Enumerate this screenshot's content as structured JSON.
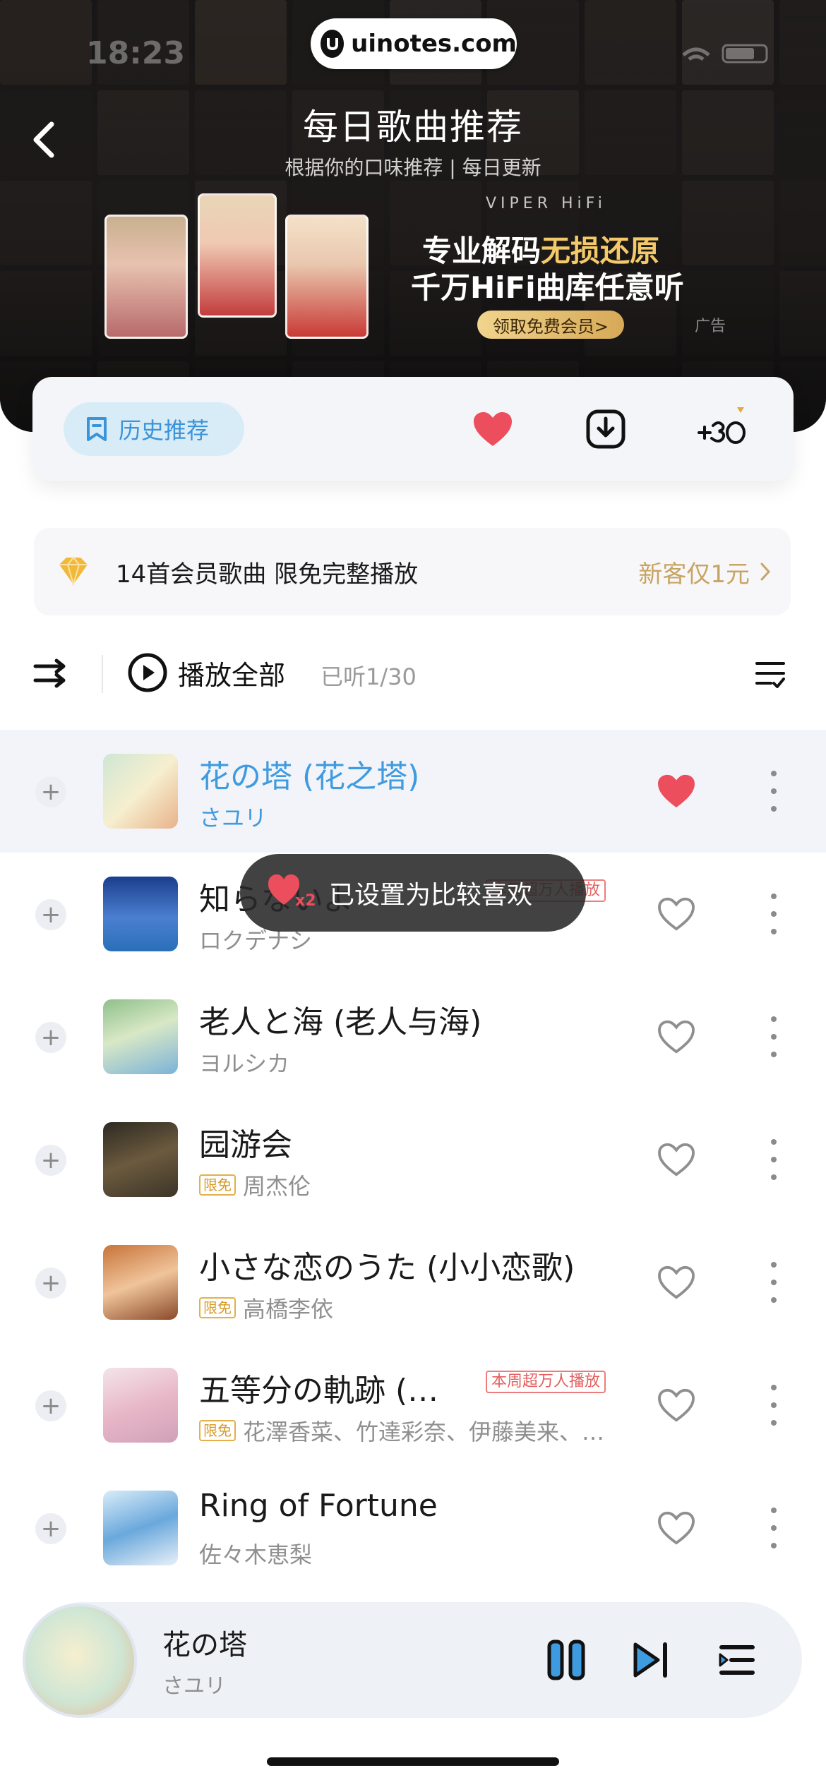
{
  "status_bar": {
    "time": "18:23"
  },
  "watermark": {
    "text": "uinotes.com"
  },
  "header": {
    "title": "每日歌曲推荐",
    "subtitle": "根据你的口味推荐 | 每日更新"
  },
  "ad": {
    "brand": "VIPER HiFi",
    "line1_a": "专业解码",
    "line1_b": "无损还原",
    "line2": "千万HiFi曲库任意听",
    "button": "领取免费会员>",
    "tag": "广告"
  },
  "toolbar": {
    "history_label": "历史推荐",
    "icons": [
      "heart-icon",
      "download-icon",
      "plus-30-icon"
    ]
  },
  "member_strip": {
    "text": "14首会员歌曲 限免完整播放",
    "promo": "新客仅1元"
  },
  "playbar": {
    "play_all": "播放全部",
    "listened": "已听1/30"
  },
  "songs": [
    {
      "title": "花の塔 (花之塔)",
      "artist": "さユリ",
      "free": false,
      "hot": "",
      "liked": true,
      "active": true
    },
    {
      "title": "知らないよ",
      "artist": "ロクデナシ",
      "free": false,
      "hot": "本周超万人播放",
      "liked": false,
      "active": false
    },
    {
      "title": "老人と海 (老人与海)",
      "artist": "ヨルシカ",
      "free": false,
      "hot": "",
      "liked": false,
      "active": false
    },
    {
      "title": "园游会",
      "artist": "周杰伦",
      "free": true,
      "hot": "",
      "liked": false,
      "active": false
    },
    {
      "title": "小さな恋のうた (小小恋歌)",
      "artist": "高橋李依",
      "free": true,
      "hot": "",
      "liked": false,
      "active": false
    },
    {
      "title": "五等分の軌跡 (…",
      "artist": "花澤香菜、竹達彩奈、伊藤美来、…",
      "free": true,
      "hot": "本周超万人播放",
      "liked": false,
      "active": false
    },
    {
      "title": "Ring of Fortune",
      "artist": "佐々木恵梨",
      "free": false,
      "hot": "",
      "liked": false,
      "active": false
    }
  ],
  "badges": {
    "free": "限免"
  },
  "toast": {
    "text": "已设置为比较喜欢",
    "multiplier": "x2"
  },
  "player": {
    "title": "花の塔",
    "artist": "さユリ",
    "state": "playing"
  },
  "colors": {
    "accent_blue": "#3f9be0",
    "heart_red": "#ec4e5e",
    "gold": "#c8a463"
  }
}
